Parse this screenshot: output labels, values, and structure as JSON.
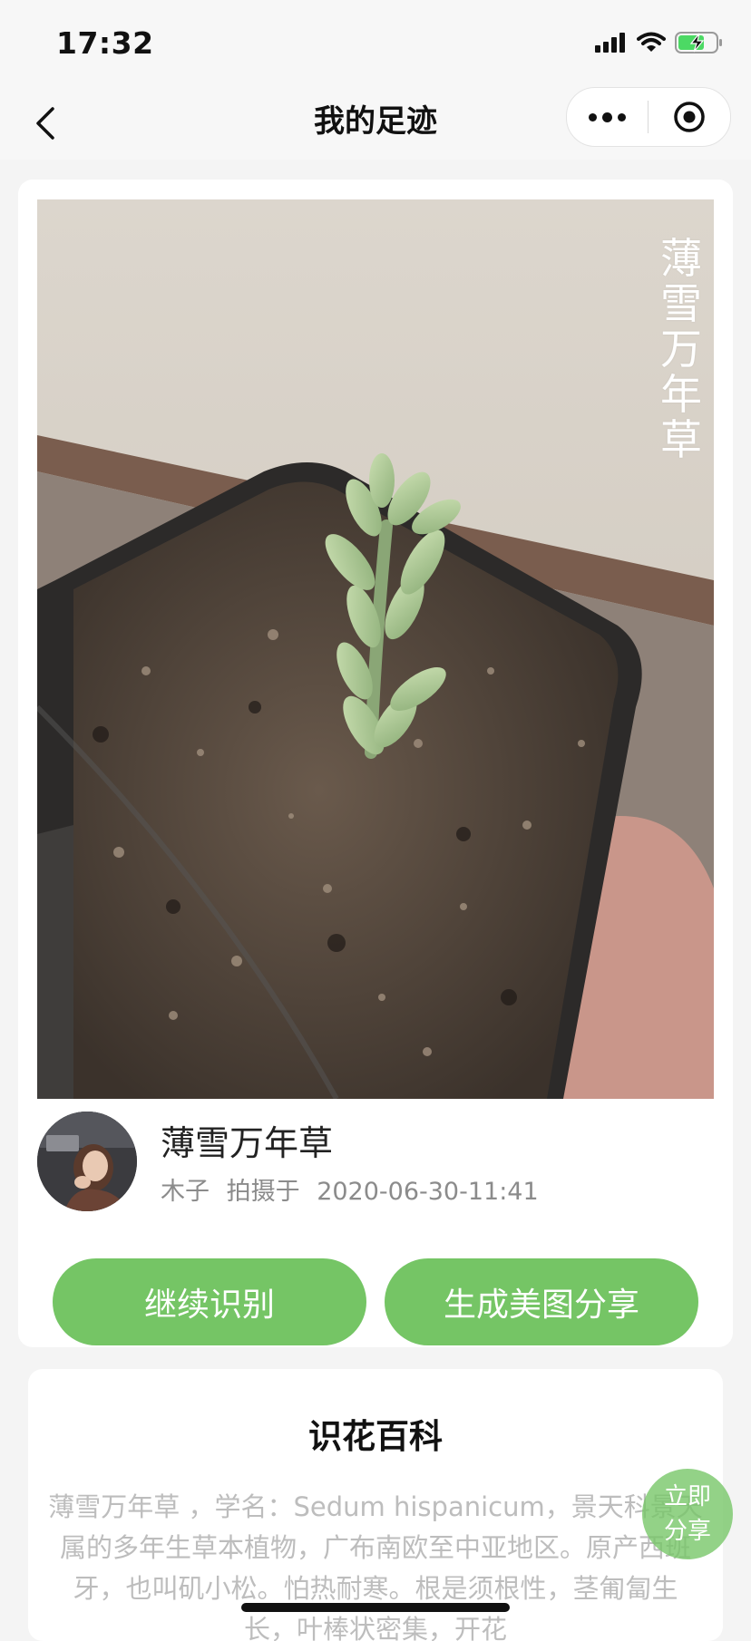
{
  "status_bar": {
    "time": "17:32",
    "icons": [
      "signal-icon",
      "wifi-icon",
      "battery-charging-icon"
    ]
  },
  "nav": {
    "title": "我的足迹",
    "icons": [
      "back-icon",
      "more-icon",
      "close-circle-icon"
    ]
  },
  "result": {
    "photo_title": "薄雪万年草",
    "plant_name": "薄雪万年草",
    "author": "木子",
    "taken_label": "拍摄于",
    "datetime": "2020-06-30-11:41"
  },
  "buttons": {
    "continue_label": "继续识别",
    "share_label": "生成美图分享"
  },
  "encyclopedia": {
    "title": "识花百科",
    "text": "薄雪万年草 ，学名：Sedum hispanicum，景天科景天属的多年生草本植物，广布南欧至中亚地区。原产西班牙，也叫矶小松。怕热耐寒。根是须根性，茎匍匐生长，叶棒状密集，开花"
  },
  "float_share": {
    "line1": "立即",
    "line2": "分享"
  },
  "colors": {
    "accent_green": "#75c565",
    "page_bg": "#f4f4f4"
  }
}
